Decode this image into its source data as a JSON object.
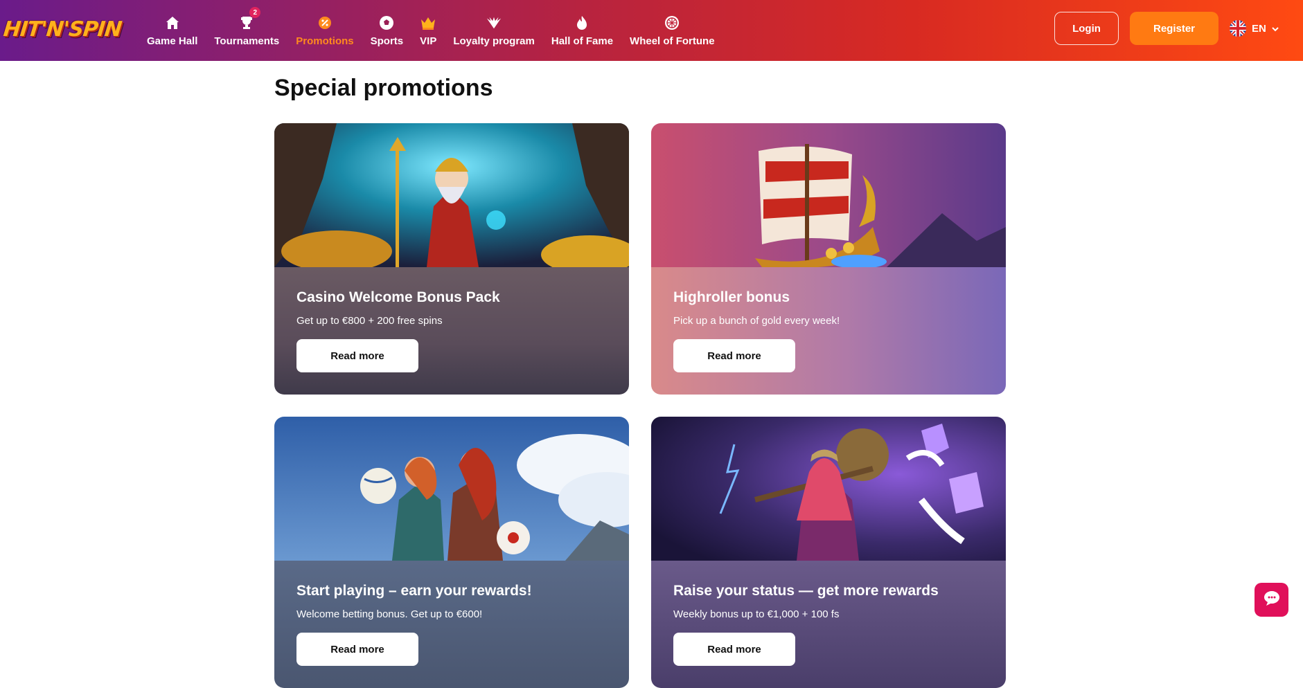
{
  "header": {
    "logo_text": "HIT'N'SPIN",
    "nav": [
      {
        "label": "Game Hall",
        "icon": "home-icon"
      },
      {
        "label": "Tournaments",
        "icon": "trophy-icon",
        "badge": "2"
      },
      {
        "label": "Promotions",
        "icon": "promo-icon",
        "active": true
      },
      {
        "label": "Sports",
        "icon": "ball-icon"
      },
      {
        "label": "VIP",
        "icon": "crown-icon"
      },
      {
        "label": "Loyalty program",
        "icon": "wings-icon"
      },
      {
        "label": "Hall of Fame",
        "icon": "flame-icon"
      },
      {
        "label": "Wheel of Fortune",
        "icon": "wheel-icon"
      }
    ],
    "login_label": "Login",
    "register_label": "Register",
    "language": "EN"
  },
  "main": {
    "title": "Special promotions",
    "promotions": [
      {
        "title": "Casino Welcome Bonus Pack",
        "description": "Get up to €800 + 200 free spins",
        "button": "Read more"
      },
      {
        "title": "Highroller bonus",
        "description": "Pick up a bunch of gold every week!",
        "button": "Read more"
      },
      {
        "title": "Start playing – earn your rewards!",
        "description": "Welcome betting bonus. Get up to €600!",
        "button": "Read more"
      },
      {
        "title": "Raise your status — get more rewards",
        "description": "Weekly bonus up to €1,000 + 100 fs",
        "button": "Read more"
      }
    ]
  },
  "colors": {
    "accent": "#ff7a12",
    "active_nav": "#ff8a1e",
    "chat": "#e0105a"
  }
}
